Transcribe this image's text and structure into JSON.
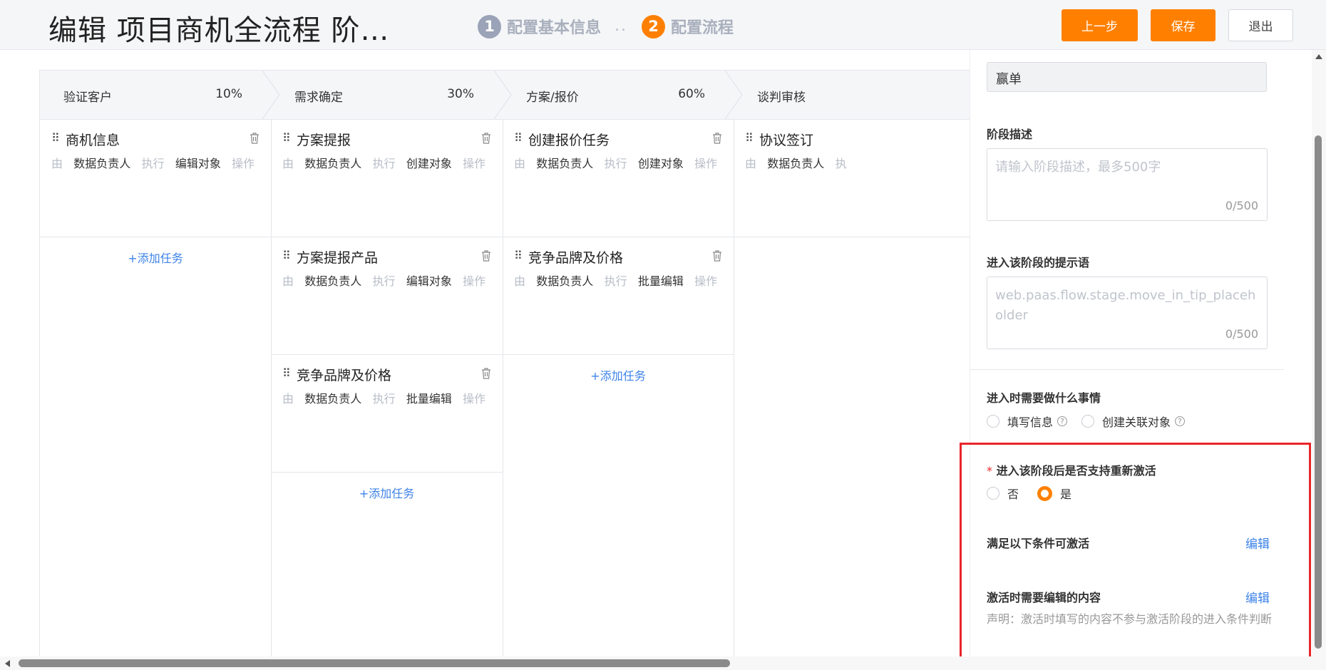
{
  "header": {
    "title": "编辑 项目商机全流程 阶…",
    "steps": [
      {
        "num": "1",
        "label": "配置基本信息"
      },
      {
        "num": "2",
        "label": "配置流程"
      }
    ],
    "step_sep": "..",
    "buttons": {
      "prev": "上一步",
      "save": "保存",
      "exit": "退出"
    }
  },
  "stages": [
    {
      "name": "验证客户",
      "pct": "10%"
    },
    {
      "name": "需求确定",
      "pct": "30%"
    },
    {
      "name": "方案/报价",
      "pct": "60%"
    },
    {
      "name": "谈判审核",
      "pct": ""
    }
  ],
  "meta_words": {
    "by": "由",
    "exec": "执行",
    "op": "操作"
  },
  "columns": [
    {
      "tasks": [
        {
          "name": "商机信息",
          "owner": "数据负责人",
          "action": "编辑对象"
        }
      ],
      "add": "+添加任务"
    },
    {
      "tasks": [
        {
          "name": "方案提报",
          "owner": "数据负责人",
          "action": "创建对象"
        },
        {
          "name": "方案提报产品",
          "owner": "数据负责人",
          "action": "编辑对象"
        },
        {
          "name": "竞争品牌及价格",
          "owner": "数据负责人",
          "action": "批量编辑"
        }
      ],
      "add": "+添加任务"
    },
    {
      "tasks": [
        {
          "name": "创建报价任务",
          "owner": "数据负责人",
          "action": "创建对象"
        },
        {
          "name": "竞争品牌及价格",
          "owner": "数据负责人",
          "action": "批量编辑"
        }
      ],
      "add": "+添加任务"
    },
    {
      "tasks": [
        {
          "name": "协议签订",
          "owner": "数据负责人",
          "action": "执"
        }
      ]
    }
  ],
  "panel": {
    "stage_target_value": "赢单",
    "desc_label": "阶段描述",
    "desc_placeholder": "请输入阶段描述，最多500字",
    "desc_count": "0/500",
    "tip_label": "进入该阶段的提示语",
    "tip_placeholder": "web.paas.flow.stage.move_in_tip_placeholder",
    "tip_count": "0/500",
    "todo_label": "进入时需要做什么事情",
    "todo_options": [
      "填写信息",
      "创建关联对象"
    ],
    "reactivate_label": "进入该阶段后是否支持重新激活",
    "reactivate_required": "*",
    "reactivate_options": {
      "no": "否",
      "yes": "是"
    },
    "reactivate_selected": "是",
    "cond_label": "满足以下条件可激活",
    "cond_edit": "编辑",
    "content_label": "激活时需要编辑的内容",
    "content_edit": "编辑",
    "note": "声明：激活时填写的内容不参与激活阶段的进入条件判断"
  },
  "colors": {
    "accent": "#ff8001",
    "link": "#3d82e8",
    "highlight": "#e8262a"
  }
}
